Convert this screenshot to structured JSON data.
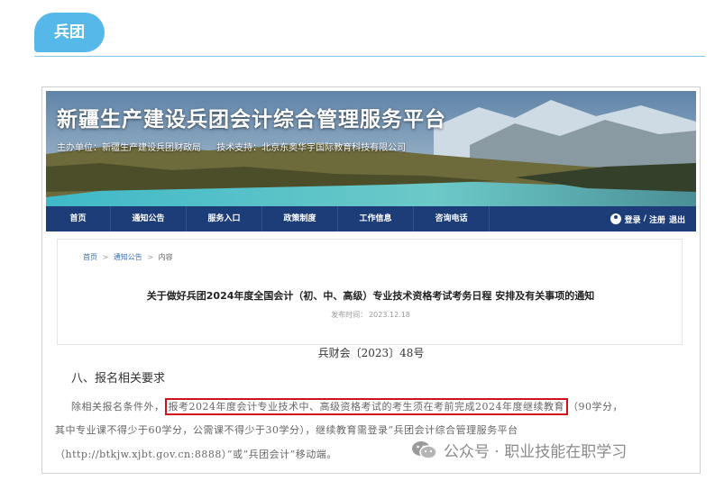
{
  "section_tag": "兵团",
  "banner": {
    "title": "新疆生产建设兵团会计综合管理服务平台",
    "organizer": "主办单位：新疆生产建设兵团财政局",
    "support": "技术支持：北京东奥华宇国际教育科技有限公司"
  },
  "nav": {
    "items": [
      {
        "label": "首页"
      },
      {
        "label": "通知公告"
      },
      {
        "label": "服务入口"
      },
      {
        "label": "政策制度"
      },
      {
        "label": "工作信息"
      },
      {
        "label": "咨询电话"
      }
    ],
    "login": "登录",
    "separator": "/",
    "register": "注册",
    "logout": "退出"
  },
  "breadcrumb": {
    "home": "首页",
    "section": "通知公告",
    "current": "内容",
    "arrow": ">"
  },
  "article": {
    "title": "关于做好兵团2024年度全国会计（初、中、高级）专业技术资格考试考务日程 安排及有关事项的通知",
    "date_label": "发布时间：",
    "date": "2023.12.18",
    "doc_number": "兵财会〔2023〕48号",
    "section_heading": "八、报名相关要求",
    "line1_pre": "除相关报名条件外，",
    "line1_highlight": "报考2024年度会计专业技术中、高级资格考试的考生须在考前完成2024年度继续教育",
    "line1_post": "（90学分，",
    "line2": "其中专业课不得少于60学分，公需课不得少于30学分），继续教育需登录“兵团会计综合管理服务平台",
    "line3": "（http://btkjw.xjbt.gov.cn:8888）”或“兵团会计”移动端。"
  },
  "watermark": {
    "text": "公众号 · 职业技能在职学习",
    "icon": "wechat-icon"
  },
  "colors": {
    "tag": "#56b8e8",
    "nav": "#1d3d78",
    "highlight_border": "#d0121b"
  }
}
